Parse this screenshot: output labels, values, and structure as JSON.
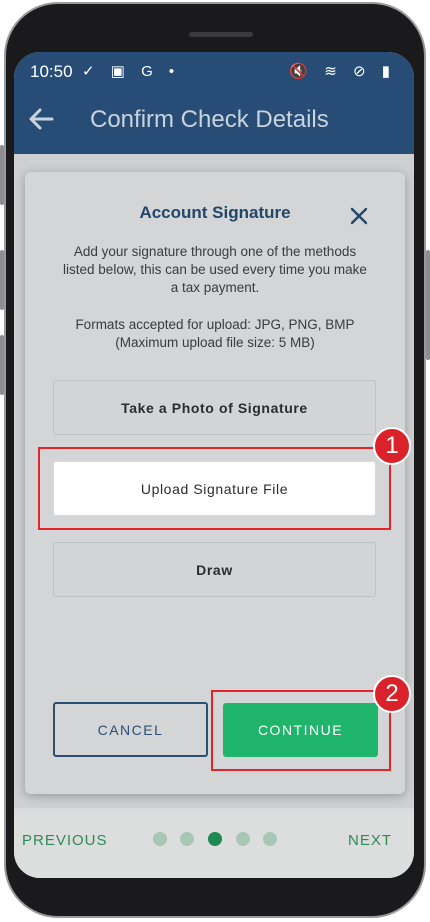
{
  "status_bar": {
    "time": "10:50",
    "left_icons": "✓ ▣ G •",
    "right_icons": "🔇 ≋ ⊘ ▮"
  },
  "header": {
    "title": "Confirm Check Details"
  },
  "dialog": {
    "title": "Account Signature",
    "description": "Add your signature through one of the methods listed below, this can be used every time you make a tax payment.",
    "formats_line1": "Formats accepted for upload: JPG, PNG, BMP",
    "formats_line2": "(Maximum upload file size: 5 MB)",
    "options": [
      {
        "label": "Take a Photo of Signature"
      },
      {
        "label": "Upload Signature File"
      },
      {
        "label": "Draw"
      }
    ],
    "cancel_label": "CANCEL",
    "continue_label": "CONTINUE"
  },
  "bottom_nav": {
    "previous_label": "PREVIOUS",
    "next_label": "NEXT",
    "page_count": 5,
    "current_page": 3
  },
  "annotations": {
    "badge_1": "1",
    "badge_2": "2"
  },
  "colors": {
    "header_bg": "#274d76",
    "title_blue": "#23466b",
    "continue_green": "#1fb56a",
    "nav_green": "#2e8a57",
    "highlight_red": "#e3242b"
  }
}
